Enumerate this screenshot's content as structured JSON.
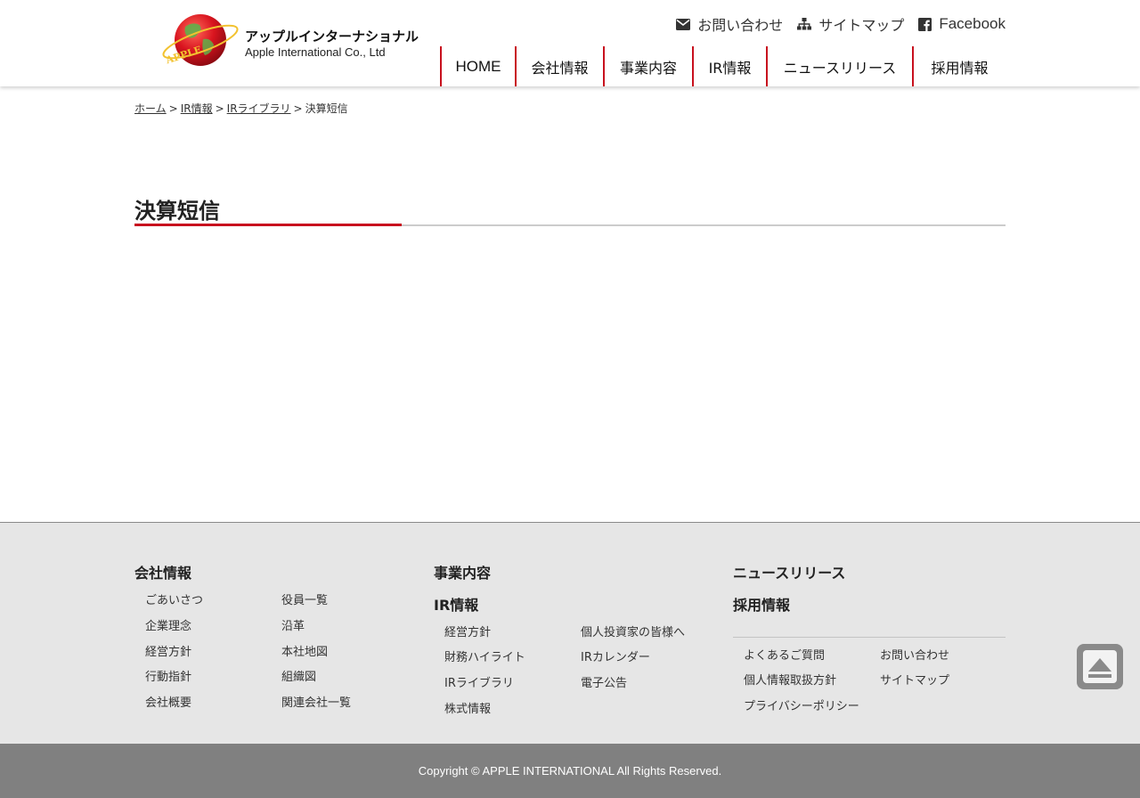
{
  "header": {
    "logo_text_jp": "アップルインターナショナル",
    "logo_text_en": "Apple International Co., Ltd",
    "logo_mark_text": "APPLE INTERNATIONAL CO.,LTD",
    "utility": [
      {
        "label": "お問い合わせ",
        "icon": "mail-icon"
      },
      {
        "label": "サイトマップ",
        "icon": "sitemap-icon"
      },
      {
        "label": "Facebook",
        "icon": "facebook-icon"
      }
    ],
    "nav": [
      "HOME",
      "会社情報",
      "事業内容",
      "IR情報",
      "ニュースリリース",
      "採用情報"
    ]
  },
  "breadcrumb": {
    "items": [
      "ホーム",
      "IR情報",
      "IRライブラリ"
    ],
    "current": "決算短信",
    "separator": ">"
  },
  "page": {
    "title": "決算短信"
  },
  "footer": {
    "col1": {
      "heading": "会社情報",
      "links_a": [
        "ごあいさつ",
        "企業理念",
        "経営方針",
        "行動指針",
        "会社概要"
      ],
      "links_b": [
        "役員一覧",
        "沿革",
        "本社地図",
        "組織図",
        "関連会社一覧"
      ]
    },
    "col2": {
      "heading1": "事業内容",
      "heading2": "IR情報",
      "links_a": [
        "経営方針",
        "財務ハイライト",
        "IRライブラリ",
        "株式情報"
      ],
      "links_b": [
        "個人投資家の皆様へ",
        "IRカレンダー",
        "電子公告"
      ]
    },
    "col3": {
      "heading1": "ニュースリリース",
      "heading2": "採用情報",
      "links_a": [
        "よくあるご質問",
        "個人情報取扱方針",
        "プライバシーポリシー"
      ],
      "links_b": [
        "お問い合わせ",
        "サイトマップ"
      ]
    },
    "copyright": "Copyright © APPLE INTERNATIONAL All Rights Reserved."
  },
  "colors": {
    "accent_red": "#c8101e",
    "footer_bg": "#e6e6e6",
    "copyright_bg": "#808080"
  }
}
